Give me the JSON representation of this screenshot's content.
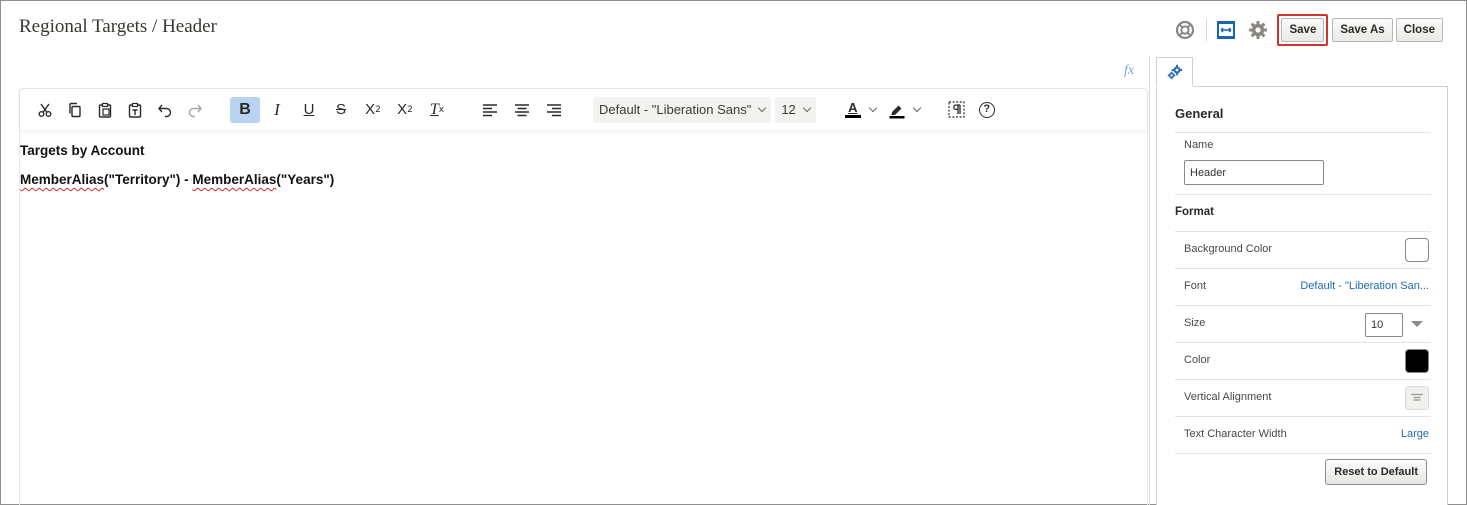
{
  "header": {
    "title": "Regional Targets / Header",
    "buttons": {
      "save": "Save",
      "save_as": "Save As",
      "close": "Close"
    },
    "icons": [
      "help-ring-icon",
      "layout-icon",
      "gear-icon"
    ]
  },
  "editor": {
    "fx_label": "fx",
    "toolbar": {
      "bold": "B",
      "italic": "I",
      "underline": "U",
      "strike": "S",
      "subscript": "X",
      "subscript_mark": "2",
      "superscript": "X",
      "superscript_mark": "2",
      "clear_format": "T",
      "clear_format_mark": "x",
      "font_family": "Default - \"Liberation Sans\"",
      "font_size": "12",
      "text_color_letter": "A",
      "help": "?"
    },
    "content": {
      "line1": "Targets by Account",
      "line2_part1": "MemberAlias",
      "line2_part2": "(\"Territory\") - ",
      "line2_part3": "MemberAlias",
      "line2_part4": "(\"Years\")"
    }
  },
  "properties": {
    "general_heading": "General",
    "name_label": "Name",
    "name_value": "Header",
    "format_heading": "Format",
    "background_color_label": "Background Color",
    "background_color": "#ffffff",
    "font_label": "Font",
    "font_value": "Default - \"Liberation San...",
    "size_label": "Size",
    "size_value": "10",
    "color_label": "Color",
    "color_value": "#000000",
    "vertical_alignment_label": "Vertical Alignment",
    "text_char_width_label": "Text Character Width",
    "text_char_width_value": "Large",
    "reset_button": "Reset to Default"
  },
  "colors": {
    "accent": "#1f6cb3",
    "save_highlight": "#d0342c",
    "active_tool": "#b8d4f2"
  }
}
